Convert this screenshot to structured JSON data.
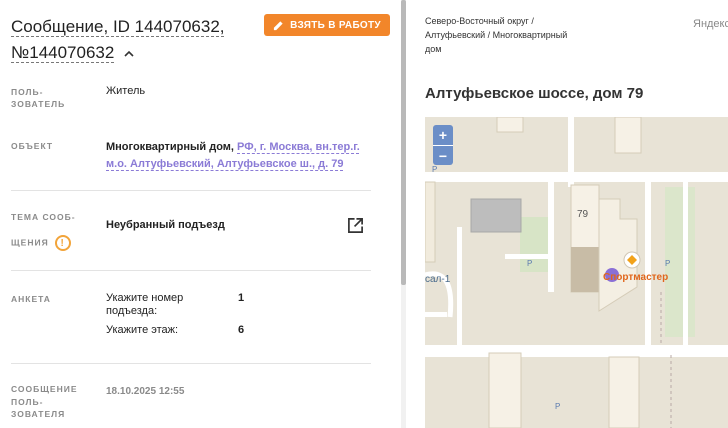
{
  "message": {
    "title": "Сообщение, ID 144070632, №144070632",
    "take_button": "ВЗЯТЬ В РАБОТУ"
  },
  "fields": {
    "user_label_1": "ПОЛЬ-",
    "user_label_2": "ЗОВАТЕЛЬ",
    "user_value": "Житель",
    "object_label": "ОБЪЕКТ",
    "object_value": "Многоквартирный дом,",
    "object_link_1": "РФ, г. Москва, вн.тер.г.",
    "object_link_2": "м.о. Алтуфьевский, Алтуфьевское ш., д. 79",
    "topic_label_1": "ТЕМА СООБ-",
    "topic_label_2": "ЩЕНИЯ",
    "topic_value": "Неубранный подъезд",
    "form_label": "АНКЕТА",
    "form_q1_line1": "Укажите номер",
    "form_q1_line2": "подъезда:",
    "form_a1": "1",
    "form_q2": "Укажите этаж:",
    "form_a2": "6",
    "msg_label_1": "СООБЩЕНИЕ",
    "msg_label_2": "ПОЛЬ-",
    "msg_label_3": "ЗОВАТЕЛЯ",
    "msg_date": "18.10.2025 12:55"
  },
  "right": {
    "breadcrumb_1": "Северо-Восточный округ /",
    "breadcrumb_2": "Алтуфьевский / Многоквартирный",
    "breadcrumb_3": "дом",
    "yandex": "Яндекс",
    "address": "Алтуфьевское шоссе, дом 79"
  },
  "map": {
    "zoom_in": "+",
    "zoom_out": "−",
    "building_number": "79",
    "poi_label": "Спортмастер",
    "street_fragment": "сал-1",
    "parking": "P"
  },
  "colors": {
    "accent": "#f2862a",
    "link": "#8b7bd6",
    "warning": "#f2a43a",
    "zoom": "#6b8ec7",
    "marker": "#8a6fd6"
  }
}
